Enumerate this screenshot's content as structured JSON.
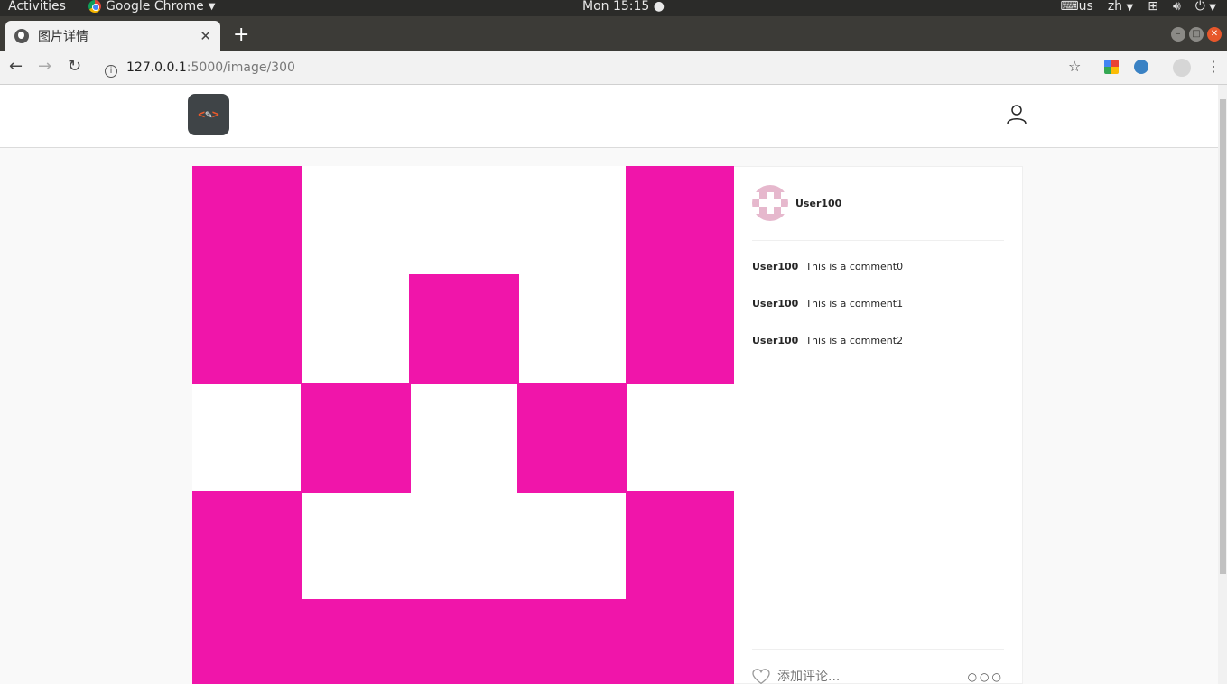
{
  "os": {
    "activities": "Activities",
    "app_name": "Google Chrome",
    "clock": "Mon 15:15 ●",
    "keyboard": "us",
    "language": "zh"
  },
  "browser": {
    "tab_title": "图片详情",
    "url_host": "127.0.0.1",
    "url_path": ":5000/image/300"
  },
  "post": {
    "author": "User100",
    "comments": [
      {
        "user": "User100",
        "text": "This is a comment0"
      },
      {
        "user": "User100",
        "text": "This is a comment1"
      },
      {
        "user": "User100",
        "text": "This is a comment2"
      }
    ],
    "add_comment_placeholder": "添加评论...",
    "more_label": "○○○"
  },
  "colors": {
    "identicon": "#f015aa",
    "avatar": "#e6b8cd"
  }
}
